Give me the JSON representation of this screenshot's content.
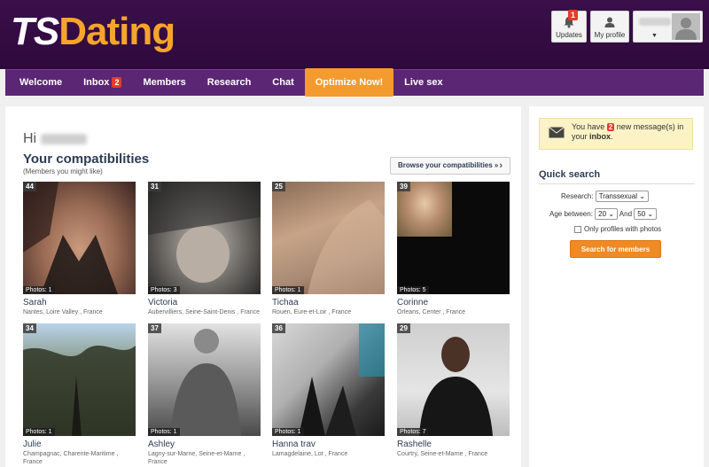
{
  "header": {
    "logo_ts": "TS",
    "logo_dating": "Dating",
    "updates_label": "Updates",
    "updates_count": "1",
    "profile_label": "My profile"
  },
  "nav": {
    "items": [
      {
        "label": "Welcome"
      },
      {
        "label": "Inbox",
        "badge": "2"
      },
      {
        "label": "Members"
      },
      {
        "label": "Research"
      },
      {
        "label": "Chat"
      },
      {
        "label": "Optimize Now!"
      },
      {
        "label": "Live sex"
      }
    ]
  },
  "main": {
    "greeting": "Hi",
    "title": "Your compatibilities",
    "subtitle": "(Members you might like)",
    "browse_label": "Browse your compatibilities »"
  },
  "cards": [
    {
      "age": "44",
      "photos": "Photos: 1",
      "name": "Sarah",
      "location": "Nantes, Loire Valley , France"
    },
    {
      "age": "31",
      "photos": "Photos: 3",
      "name": "Victoria",
      "location": "Aubervilliers, Seine-Saint-Denis , France"
    },
    {
      "age": "25",
      "photos": "Photos: 1",
      "name": "Tichaa",
      "location": "Rouen, Eure-et-Loir , France"
    },
    {
      "age": "39",
      "photos": "Photos: 5",
      "name": "Corinne",
      "location": "Orleans, Center , France"
    },
    {
      "age": "34",
      "photos": "Photos: 1",
      "name": "Julie",
      "location": "Champagnac, Charente-Maritime , France"
    },
    {
      "age": "37",
      "photos": "Photos: 1",
      "name": "Ashley",
      "location": "Lagny-sur-Marne, Seine-et-Marne , France"
    },
    {
      "age": "36",
      "photos": "Photos: 1",
      "name": "Hanna trav",
      "location": "Lamagdelaine, Lot , France"
    },
    {
      "age": "29",
      "photos": "Photos: 7",
      "name": "Rashelle",
      "location": "Courtry, Seine-et-Marne , France"
    }
  ],
  "sidebar": {
    "msg_pre": "You have",
    "msg_count": "2",
    "msg_post": "new message(s) in your",
    "msg_link": "inbox",
    "msg_end": ".",
    "qs_title": "Quick search",
    "research_label": "Research:",
    "research_value": "Transsexual",
    "age_label": "Age between:",
    "age_min": "20",
    "and_label": "And",
    "age_max": "50",
    "photos_only_label": "Only profiles with photos",
    "search_button": "Search for members"
  },
  "colors": {
    "header_bg": "#2e0a3c",
    "nav_bg": "#5b2673",
    "accent_orange": "#f39b2e",
    "badge_red": "#e43b2a",
    "title_navy": "#2e3c55"
  }
}
